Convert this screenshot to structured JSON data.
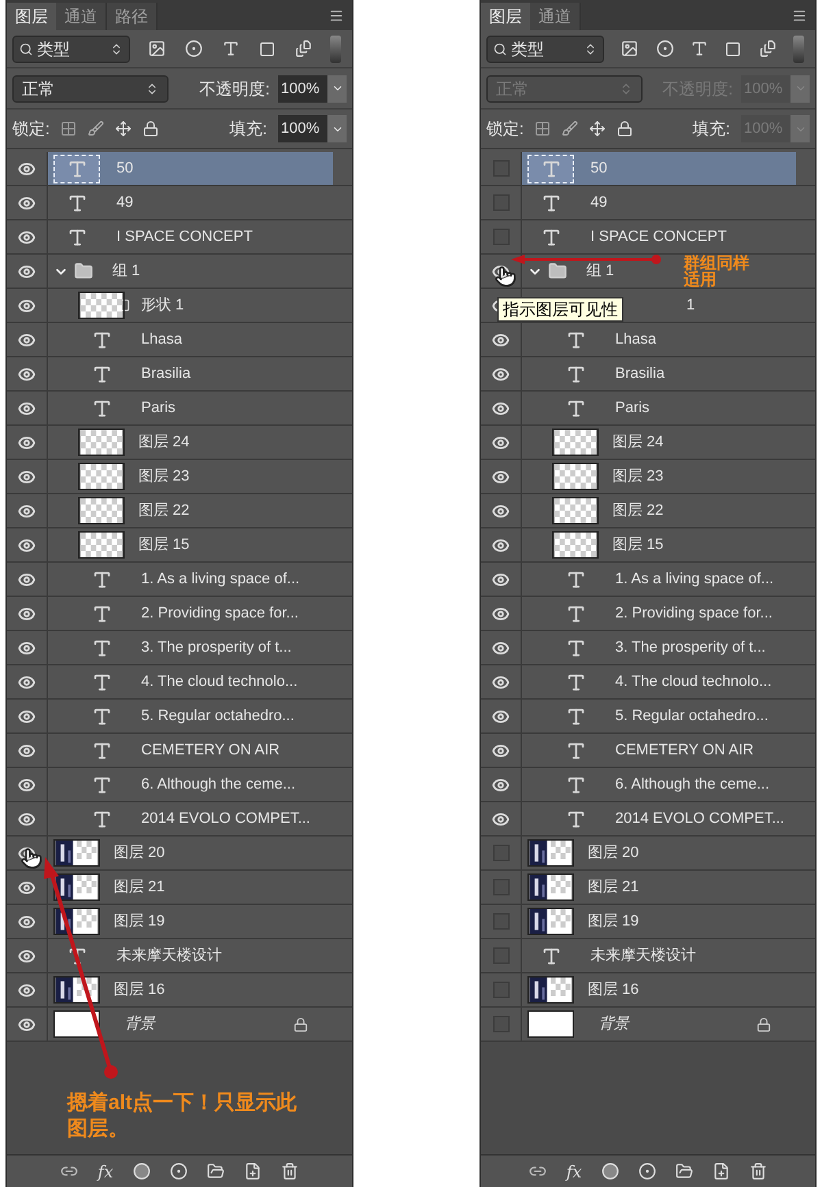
{
  "panels": [
    {
      "tabs": [
        {
          "label": "图层",
          "selected": true
        },
        {
          "label": "通道",
          "selected": false
        },
        {
          "label": "路径",
          "selected": false
        }
      ],
      "filter": {
        "label": "类型"
      },
      "blend_mode": "正常",
      "opacity_label": "不透明度:",
      "opacity": "100%",
      "lock_label": "锁定:",
      "fill_label": "填充:",
      "fill": "100%",
      "disabled": false,
      "fx_label": "fx",
      "layers": [
        {
          "name": "50",
          "kind": "text",
          "visible": true,
          "selected": true,
          "hovered": false
        },
        {
          "name": "49",
          "kind": "text",
          "visible": true,
          "selected": false,
          "hovered": false
        },
        {
          "name": "I  SPACE CONCEPT",
          "kind": "text",
          "visible": true,
          "selected": false,
          "hovered": false
        },
        {
          "name": "组 1",
          "kind": "group",
          "visible": true,
          "selected": false,
          "hovered": false,
          "expanded": true,
          "children": [
            {
              "name": "形状 1",
              "kind": "shape",
              "visible": true,
              "selected": false,
              "hovered": false
            },
            {
              "name": "Lhasa",
              "kind": "text",
              "visible": true,
              "selected": false,
              "hovered": false
            },
            {
              "name": "Brasilia",
              "kind": "text",
              "visible": true,
              "selected": false,
              "hovered": false
            },
            {
              "name": "Paris",
              "kind": "text",
              "visible": true,
              "selected": false,
              "hovered": false
            },
            {
              "name": "图层 24",
              "kind": "pixel",
              "visible": true,
              "selected": false,
              "hovered": false
            },
            {
              "name": "图层 23",
              "kind": "pixel",
              "visible": true,
              "selected": false,
              "hovered": false
            },
            {
              "name": "图层 22",
              "kind": "pixel",
              "visible": true,
              "selected": false,
              "hovered": false
            },
            {
              "name": "图层 15",
              "kind": "pixel",
              "visible": true,
              "selected": false,
              "hovered": false
            },
            {
              "name": "1. As a living space of...",
              "kind": "text",
              "visible": true,
              "selected": false,
              "hovered": false
            },
            {
              "name": "2. Providing space for...",
              "kind": "text",
              "visible": true,
              "selected": false,
              "hovered": false
            },
            {
              "name": "3. The prosperity of t...",
              "kind": "text",
              "visible": true,
              "selected": false,
              "hovered": false
            },
            {
              "name": "4. The cloud technolo...",
              "kind": "text",
              "visible": true,
              "selected": false,
              "hovered": false
            },
            {
              "name": "5. Regular octahedro...",
              "kind": "text",
              "visible": true,
              "selected": false,
              "hovered": false
            },
            {
              "name": "CEMETERY ON AIR",
              "kind": "text",
              "visible": true,
              "selected": false,
              "hovered": false
            },
            {
              "name": "6. Although the ceme...",
              "kind": "text",
              "visible": true,
              "selected": false,
              "hovered": false
            },
            {
              "name": "2014 EVOLO COMPET...",
              "kind": "text",
              "visible": true,
              "selected": false,
              "hovered": false
            }
          ]
        },
        {
          "name": "图层 20",
          "kind": "photo",
          "visible": true,
          "selected": false,
          "hovered": true
        },
        {
          "name": "图层 21",
          "kind": "photo",
          "visible": true,
          "selected": false,
          "hovered": false
        },
        {
          "name": "图层 19",
          "kind": "photo",
          "visible": true,
          "selected": false,
          "hovered": false
        },
        {
          "name": "未来摩天楼设计",
          "kind": "text",
          "visible": true,
          "selected": false,
          "hovered": false
        },
        {
          "name": "图层 16",
          "kind": "photo",
          "visible": true,
          "selected": false,
          "hovered": false
        },
        {
          "name": "背景",
          "kind": "background",
          "visible": true,
          "selected": false,
          "hovered": false
        }
      ],
      "annotation": {
        "kind": "vertical",
        "text": "摁着alt点一下！只显示此图层。"
      }
    },
    {
      "tabs": [
        {
          "label": "图层",
          "selected": true
        },
        {
          "label": "通道",
          "selected": false
        }
      ],
      "filter": {
        "label": "类型"
      },
      "blend_mode": "正常",
      "opacity_label": "不透明度:",
      "opacity": "100%",
      "lock_label": "锁定:",
      "fill_label": "填充:",
      "fill": "100%",
      "disabled": true,
      "fx_label": "fx",
      "layers": [
        {
          "name": "50",
          "kind": "text",
          "visible": false,
          "selected": true,
          "hovered": false
        },
        {
          "name": "49",
          "kind": "text",
          "visible": false,
          "selected": false,
          "hovered": false
        },
        {
          "name": "I  SPACE CONCEPT",
          "kind": "text",
          "visible": false,
          "selected": false,
          "hovered": false
        },
        {
          "name": "组 1",
          "kind": "group",
          "visible": true,
          "selected": false,
          "hovered": true,
          "expanded": true,
          "note": "群组同样适用",
          "children": [
            {
              "name": "1",
              "kind": "shape",
              "visible": true,
              "selected": false,
              "hovered": false,
              "tooltip": "指示图层可见性"
            },
            {
              "name": "Lhasa",
              "kind": "text",
              "visible": true,
              "selected": false,
              "hovered": false
            },
            {
              "name": "Brasilia",
              "kind": "text",
              "visible": true,
              "selected": false,
              "hovered": false
            },
            {
              "name": "Paris",
              "kind": "text",
              "visible": true,
              "selected": false,
              "hovered": false
            },
            {
              "name": "图层 24",
              "kind": "pixel",
              "visible": true,
              "selected": false,
              "hovered": false
            },
            {
              "name": "图层 23",
              "kind": "pixel",
              "visible": true,
              "selected": false,
              "hovered": false
            },
            {
              "name": "图层 22",
              "kind": "pixel",
              "visible": true,
              "selected": false,
              "hovered": false
            },
            {
              "name": "图层 15",
              "kind": "pixel",
              "visible": true,
              "selected": false,
              "hovered": false
            },
            {
              "name": "1. As a living space of...",
              "kind": "text",
              "visible": true,
              "selected": false,
              "hovered": false
            },
            {
              "name": "2. Providing space for...",
              "kind": "text",
              "visible": true,
              "selected": false,
              "hovered": false
            },
            {
              "name": "3. The prosperity of t...",
              "kind": "text",
              "visible": true,
              "selected": false,
              "hovered": false
            },
            {
              "name": "4. The cloud technolo...",
              "kind": "text",
              "visible": true,
              "selected": false,
              "hovered": false
            },
            {
              "name": "5. Regular octahedro...",
              "kind": "text",
              "visible": true,
              "selected": false,
              "hovered": false
            },
            {
              "name": "CEMETERY ON AIR",
              "kind": "text",
              "visible": true,
              "selected": false,
              "hovered": false
            },
            {
              "name": "6. Although the ceme...",
              "kind": "text",
              "visible": true,
              "selected": false,
              "hovered": false
            },
            {
              "name": "2014 EVOLO COMPET...",
              "kind": "text",
              "visible": true,
              "selected": false,
              "hovered": false
            }
          ]
        },
        {
          "name": "图层 20",
          "kind": "photo",
          "visible": false,
          "selected": false,
          "hovered": false
        },
        {
          "name": "图层 21",
          "kind": "photo",
          "visible": false,
          "selected": false,
          "hovered": false
        },
        {
          "name": "图层 19",
          "kind": "photo",
          "visible": false,
          "selected": false,
          "hovered": false
        },
        {
          "name": "未来摩天楼设计",
          "kind": "text",
          "visible": false,
          "selected": false,
          "hovered": false
        },
        {
          "name": "图层 16",
          "kind": "photo",
          "visible": false,
          "selected": false,
          "hovered": false
        },
        {
          "name": "背景",
          "kind": "background",
          "visible": false,
          "selected": false,
          "hovered": false
        }
      ]
    }
  ]
}
